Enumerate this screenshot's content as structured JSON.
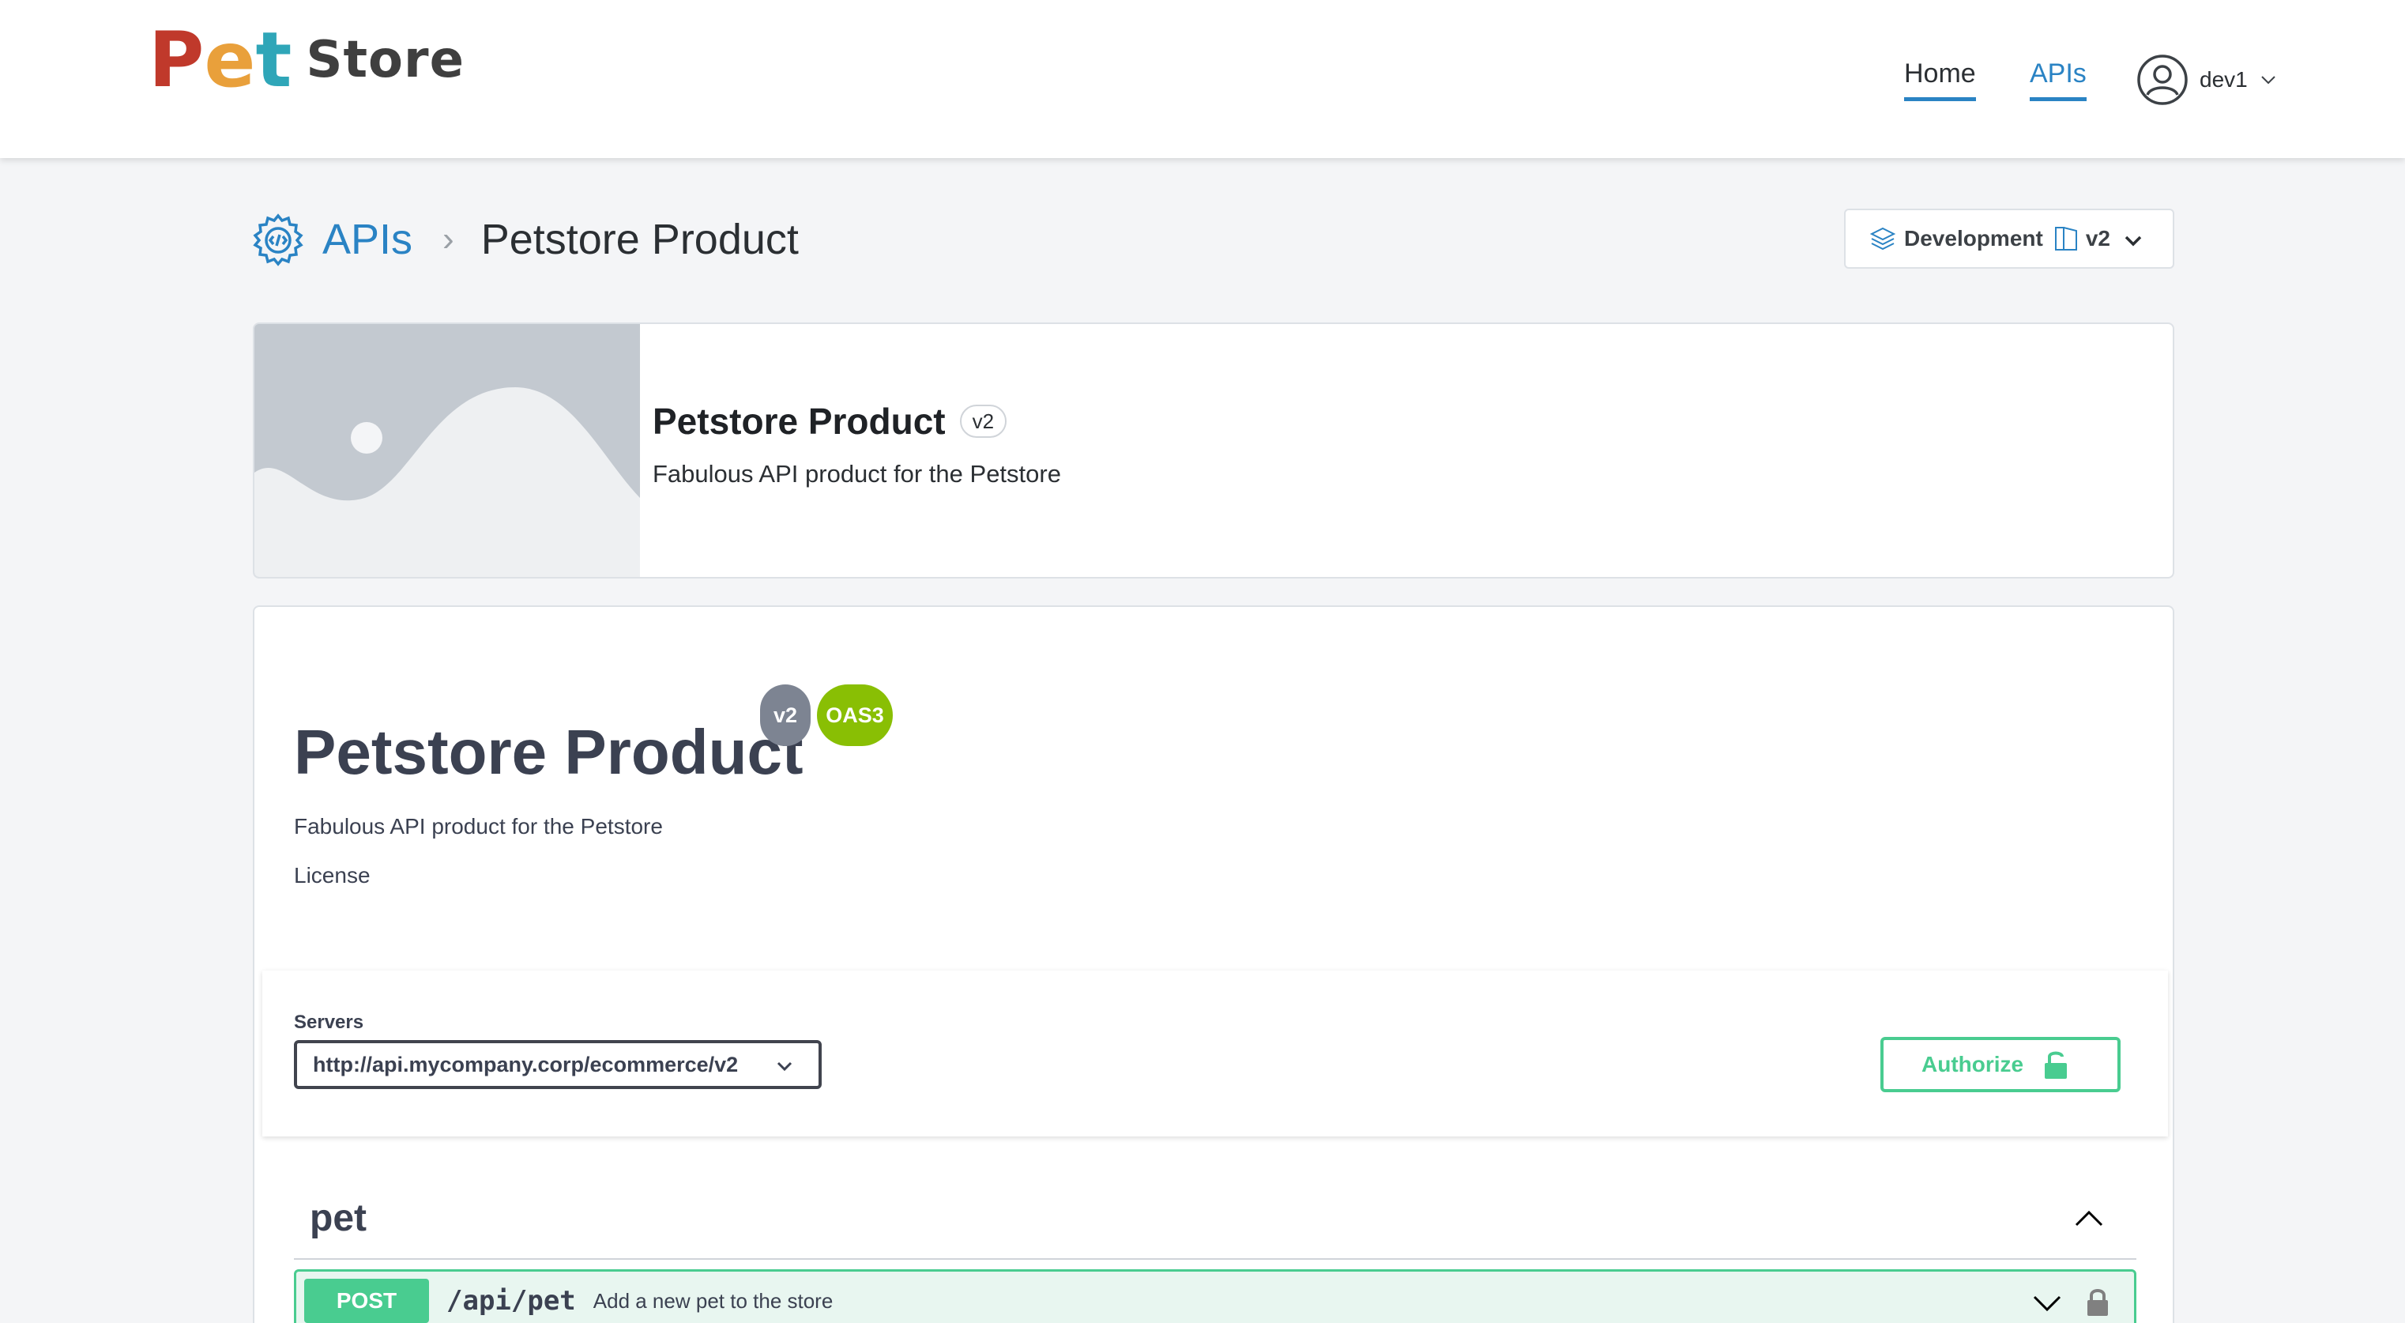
{
  "header": {
    "logo": {
      "letters": [
        "P",
        "e",
        "t"
      ],
      "letter_colors": [
        "#c0392b",
        "#e9a03b",
        "#2fa6b8"
      ],
      "word": "Store"
    },
    "nav": [
      {
        "label": "Home",
        "active": false
      },
      {
        "label": "APIs",
        "active": true
      }
    ],
    "user": {
      "name": "dev1",
      "icon": "user-circle-icon"
    }
  },
  "breadcrumb": {
    "root_label": "APIs",
    "separator": "›",
    "current": "Petstore Product"
  },
  "environment": {
    "env_label": "Development",
    "version_label": "v2"
  },
  "product_card": {
    "title": "Petstore Product",
    "version": "v2",
    "description": "Fabulous API product for the Petstore"
  },
  "swagger": {
    "title": "Petstore Product",
    "version_badge": "v2",
    "oas_badge": "OAS3",
    "description": "Fabulous API product for the Petstore",
    "license_label": "License",
    "servers_label": "Servers",
    "server_selected": "http://api.mycompany.corp/ecommerce/v2",
    "authorize_label": "Authorize",
    "tags": [
      {
        "name": "pet",
        "expanded": true,
        "operations": [
          {
            "method": "POST",
            "path": "/api/pet",
            "summary": "Add a new pet to the store"
          }
        ]
      }
    ]
  },
  "colors": {
    "accent": "#2a83c4",
    "post_green": "#49cc90",
    "oas_badge": "#89bf04",
    "version_badge": "#7d8492"
  }
}
